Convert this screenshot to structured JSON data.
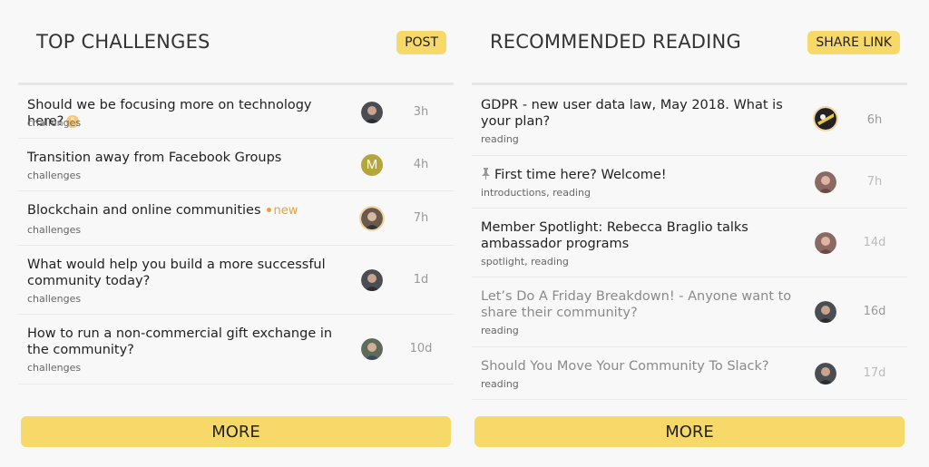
{
  "left": {
    "title": "TOP CHALLENGES",
    "action_label": "POST",
    "more_label": "MORE",
    "topics": [
      {
        "title": "Should we be focusing more on technology here?",
        "badge": "5",
        "category": "challenges",
        "age": "3h"
      },
      {
        "title": "Transition away from Facebook Groups",
        "category": "challenges",
        "age": "4h",
        "avatar_letter": "M"
      },
      {
        "title": "Blockchain and online communities",
        "new_label": "new",
        "category": "challenges",
        "age": "7h"
      },
      {
        "title": "What would help you build a more successful community today?",
        "category": "challenges",
        "age": "1d"
      },
      {
        "title": "How to run a non-commercial gift exchange in the community?",
        "category": "challenges",
        "age": "10d"
      }
    ]
  },
  "right": {
    "title": "RECOMMENDED READING",
    "action_label": "SHARE LINK",
    "more_label": "MORE",
    "topics": [
      {
        "title": "GDPR - new user data law, May 2018. What is your plan?",
        "category": "reading",
        "age": "6h"
      },
      {
        "title": "First time here? Welcome!",
        "category": "introductions, reading",
        "age": "7h"
      },
      {
        "title": "Member Spotlight: Rebecca Braglio talks ambassador programs",
        "category": "spotlight, reading",
        "age": "14d"
      },
      {
        "title": "Let’s Do A Friday Breakdown! - Anyone want to share their community?",
        "category": "reading",
        "age": "16d"
      },
      {
        "title": "Should You Move Your Community To Slack?",
        "category": "reading",
        "age": "17d"
      }
    ]
  },
  "colors": {
    "accent": "#f7d96a",
    "new": "#e9a23b",
    "badge": "#f6c77a"
  },
  "icons": {
    "pinned": "pin-icon"
  }
}
